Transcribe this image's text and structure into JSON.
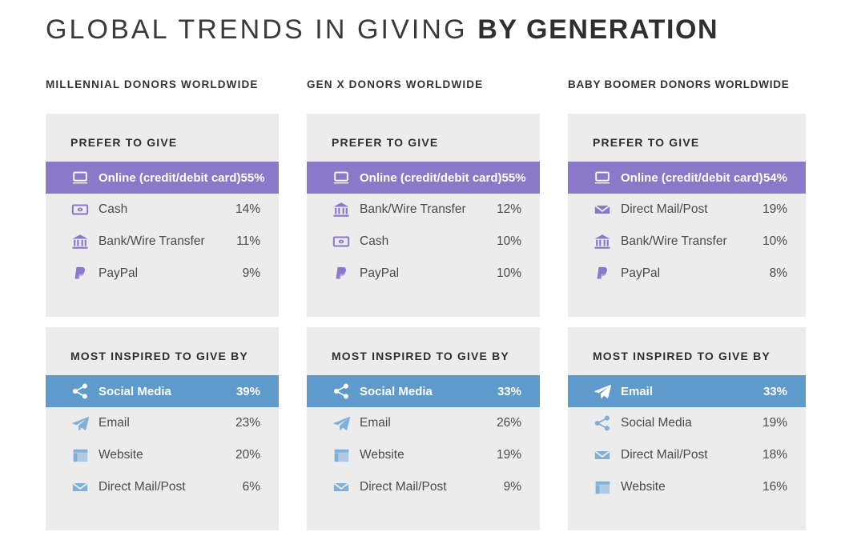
{
  "title": {
    "light": "GLOBAL TRENDS IN GIVING ",
    "bold": "BY GENERATION"
  },
  "colors": {
    "purple_highlight": "#8a79c8",
    "blue_highlight": "#5e9acb",
    "card_background": "#ececec",
    "page_background": "#ffffff",
    "text": "#4a4a4a",
    "heading": "#2e2e2e"
  },
  "columns": [
    {
      "header": "MILLENNIAL DONORS WORLDWIDE",
      "cards": [
        {
          "title": "PREFER TO GIVE",
          "accent": "purple",
          "rows": [
            {
              "icon": "laptop-icon",
              "label": "Online (credit/debit card)",
              "value": "55%",
              "highlighted": true
            },
            {
              "icon": "banknote-icon",
              "label": "Cash",
              "value": "14%",
              "highlighted": false
            },
            {
              "icon": "bank-icon",
              "label": "Bank/Wire Transfer",
              "value": "11%",
              "highlighted": false
            },
            {
              "icon": "paypal-icon",
              "label": "PayPal",
              "value": "9%",
              "highlighted": false
            }
          ]
        },
        {
          "title": "MOST INSPIRED TO GIVE BY",
          "accent": "blue",
          "rows": [
            {
              "icon": "share-icon",
              "label": "Social Media",
              "value": "39%",
              "highlighted": true
            },
            {
              "icon": "paperplane-icon",
              "label": "Email",
              "value": "23%",
              "highlighted": false
            },
            {
              "icon": "website-icon",
              "label": "Website",
              "value": "20%",
              "highlighted": false
            },
            {
              "icon": "envelope-icon",
              "label": "Direct Mail/Post",
              "value": "6%",
              "highlighted": false
            }
          ]
        }
      ]
    },
    {
      "header": "GEN X DONORS WORLDWIDE",
      "cards": [
        {
          "title": "PREFER TO GIVE",
          "accent": "purple",
          "rows": [
            {
              "icon": "laptop-icon",
              "label": "Online (credit/debit card)",
              "value": "55%",
              "highlighted": true
            },
            {
              "icon": "bank-icon",
              "label": "Bank/Wire Transfer",
              "value": "12%",
              "highlighted": false
            },
            {
              "icon": "banknote-icon",
              "label": "Cash",
              "value": "10%",
              "highlighted": false
            },
            {
              "icon": "paypal-icon",
              "label": "PayPal",
              "value": "10%",
              "highlighted": false
            }
          ]
        },
        {
          "title": "MOST INSPIRED TO GIVE BY",
          "accent": "blue",
          "rows": [
            {
              "icon": "share-icon",
              "label": "Social Media",
              "value": "33%",
              "highlighted": true
            },
            {
              "icon": "paperplane-icon",
              "label": "Email",
              "value": "26%",
              "highlighted": false
            },
            {
              "icon": "website-icon",
              "label": "Website",
              "value": "19%",
              "highlighted": false
            },
            {
              "icon": "envelope-icon",
              "label": "Direct Mail/Post",
              "value": "9%",
              "highlighted": false
            }
          ]
        }
      ]
    },
    {
      "header": "BABY BOOMER DONORS WORLDWIDE",
      "cards": [
        {
          "title": "PREFER TO GIVE",
          "accent": "purple",
          "rows": [
            {
              "icon": "laptop-icon",
              "label": "Online (credit/debit card)",
              "value": "54%",
              "highlighted": true
            },
            {
              "icon": "envelope-icon",
              "label": "Direct Mail/Post",
              "value": "19%",
              "highlighted": false
            },
            {
              "icon": "bank-icon",
              "label": "Bank/Wire Transfer",
              "value": "10%",
              "highlighted": false
            },
            {
              "icon": "paypal-icon",
              "label": "PayPal",
              "value": "8%",
              "highlighted": false
            }
          ]
        },
        {
          "title": "MOST INSPIRED TO GIVE BY",
          "accent": "blue",
          "rows": [
            {
              "icon": "paperplane-icon",
              "label": "Email",
              "value": "33%",
              "highlighted": true
            },
            {
              "icon": "share-icon",
              "label": "Social Media",
              "value": "19%",
              "highlighted": false
            },
            {
              "icon": "envelope-icon",
              "label": "Direct Mail/Post",
              "value": "18%",
              "highlighted": false
            },
            {
              "icon": "website-icon",
              "label": "Website",
              "value": "16%",
              "highlighted": false
            }
          ]
        }
      ]
    }
  ]
}
